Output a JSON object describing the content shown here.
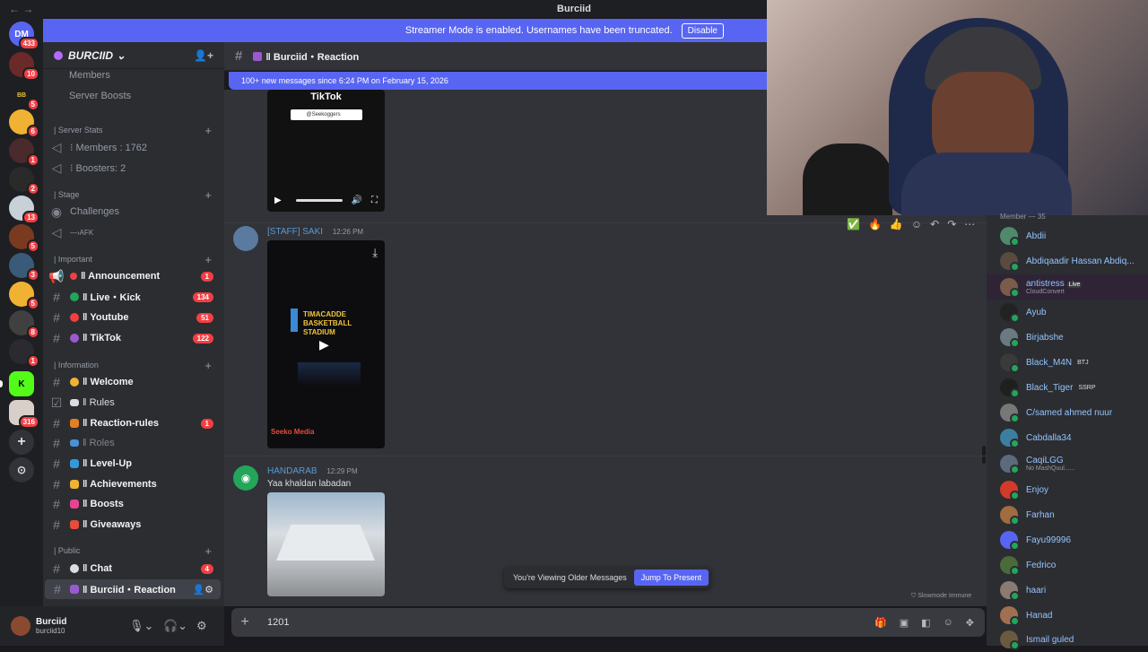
{
  "window": {
    "title": "Burciid"
  },
  "streamer_bar": {
    "text": "Streamer Mode is enabled. Usernames have been truncated.",
    "button": "Disable"
  },
  "server_rail": {
    "badges": [
      "433",
      "10",
      "5",
      "6",
      "1",
      "2",
      "13",
      "5",
      "3",
      "5",
      "8",
      "1",
      "316"
    ]
  },
  "guild": {
    "name": "BURCIID"
  },
  "sidebar": {
    "top_items": [
      "Members",
      "Server Boosts"
    ],
    "stats_category": "| Server Stats",
    "members_count": "⁝ Members : 1762",
    "boosters_count": "⁝ Boosters: 2",
    "stage_category": "| Stage",
    "challenges": "Challenges",
    "afk": "—›AFK",
    "important_category": "| Important",
    "important_channels": [
      {
        "label": "‖ Announcement",
        "badge": "1"
      },
      {
        "label": "‖ Live・Kick",
        "badge": "134"
      },
      {
        "label": "‖ Youtube",
        "badge": "51"
      },
      {
        "label": "‖ TikTok",
        "badge": "122"
      }
    ],
    "info_category": "| Information",
    "info_channels": [
      {
        "label": "‖ Welcome",
        "badge": ""
      },
      {
        "label": "‖ Rules",
        "badge": ""
      },
      {
        "label": "‖ Reaction-rules",
        "badge": "1"
      },
      {
        "label": "‖ Roles",
        "badge": ""
      },
      {
        "label": "‖ Level-Up",
        "badge": ""
      },
      {
        "label": "‖ Achievements",
        "badge": ""
      },
      {
        "label": "‖ Boosts",
        "badge": ""
      },
      {
        "label": "‖ Giveaways",
        "badge": ""
      }
    ],
    "public_category": "| Public",
    "public_channels": [
      {
        "label": "‖ Chat",
        "badge": "4"
      },
      {
        "label": "‖ Burciid・Reaction",
        "badge": ""
      }
    ]
  },
  "user": {
    "name": "Burciid",
    "tag": "burciid10"
  },
  "channel": {
    "title": "‖ Burciid・Reaction"
  },
  "new_messages_bar": "100+ new messages since 6:24 PM on February 15, 2026",
  "messages": [
    {
      "author": "[STAFF] SAKI",
      "time": "12:26 PM",
      "video_caption": "Seeko Media",
      "video_text": "TIMACADDE BASKETBALL STADIUM"
    },
    {
      "author": "HANDARAB",
      "time": "12:29 PM",
      "text": "Yaa khaldan labadan"
    }
  ],
  "top_video": {
    "title": "TikTok",
    "search_text": "@Seekoggers"
  },
  "older_bar": {
    "text": "You're Viewing Older Messages",
    "button": "Jump To Present"
  },
  "slowmode": "Slowmode Immune",
  "composer": {
    "value": "1201"
  },
  "members_header": "Member — 35",
  "members": [
    {
      "name": "Abdii",
      "sub": "",
      "color": "#4f8a6a"
    },
    {
      "name": "Abdiqaadir Hassan Abdiq...",
      "sub": "",
      "color": "#5a4a3f"
    },
    {
      "name": "antistress",
      "sub": "CloudConvert",
      "color": "#7a5c4a",
      "tag": "Live"
    },
    {
      "name": "Ayub",
      "sub": "",
      "color": "#222"
    },
    {
      "name": "Birjabshe",
      "sub": "",
      "color": "#6b7a80"
    },
    {
      "name": "Black_M4N",
      "sub": "",
      "color": "#3a3a3a",
      "tag": "BTJ"
    },
    {
      "name": "Black_Tiger",
      "sub": "",
      "color": "#1f1f1f",
      "tag": "SSRP"
    },
    {
      "name": "C/samed ahmed nuur",
      "sub": "",
      "color": "#777"
    },
    {
      "name": "Cabdalla34",
      "sub": "",
      "color": "#3b7fa0"
    },
    {
      "name": "CaqiLGG",
      "sub": "No MashQuul......",
      "color": "#5b6b7b"
    },
    {
      "name": "Enjoy",
      "sub": "",
      "color": "#d23a2a"
    },
    {
      "name": "Farhan",
      "sub": "",
      "color": "#a06c40"
    },
    {
      "name": "Fayu99996",
      "sub": "",
      "color": "#5865f2"
    },
    {
      "name": "Fedrico",
      "sub": "",
      "color": "#4a6a3a"
    },
    {
      "name": "haari",
      "sub": "",
      "color": "#8a7a70"
    },
    {
      "name": "Hanad",
      "sub": "",
      "color": "#a07050"
    },
    {
      "name": "Ismail guled",
      "sub": "",
      "color": "#6a5a40"
    }
  ],
  "colors": {
    "accent": "#5865f2",
    "badge": "#f23f43",
    "member_name": "#94c4ff"
  }
}
